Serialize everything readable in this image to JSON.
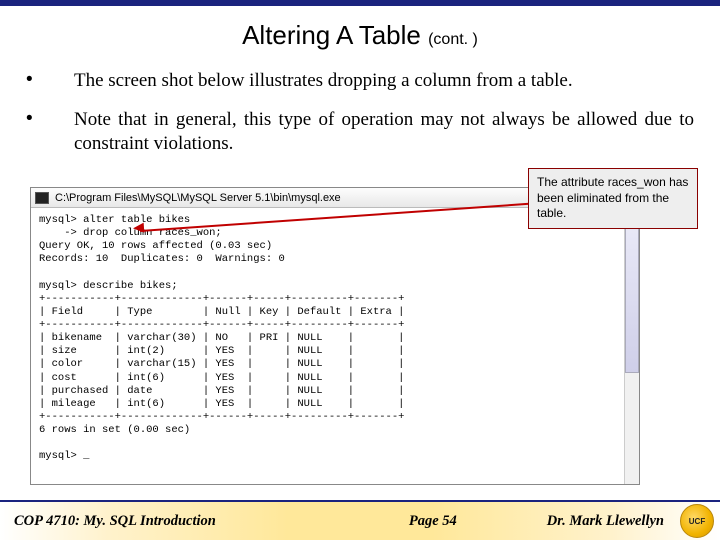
{
  "title": {
    "main": "Altering A Table",
    "cont": "(cont. )"
  },
  "bullets": [
    "The screen shot below illustrates dropping a column from a table.",
    "Note that in general, this type of operation may not always be allowed due to constraint violations."
  ],
  "callout": "The attribute races_won has been eliminated from the table.",
  "screenshot": {
    "path": "C:\\Program Files\\MySQL\\MySQL Server 5.1\\bin\\mysql.exe",
    "lines": [
      "mysql> alter table bikes",
      "    -> drop column races_won;",
      "Query OK, 10 rows affected (0.03 sec)",
      "Records: 10  Duplicates: 0  Warnings: 0",
      "",
      "mysql> describe bikes;",
      "+-----------+-------------+------+-----+---------+-------+",
      "| Field     | Type        | Null | Key | Default | Extra |",
      "+-----------+-------------+------+-----+---------+-------+",
      "| bikename  | varchar(30) | NO   | PRI | NULL    |       |",
      "| size      | int(2)      | YES  |     | NULL    |       |",
      "| color     | varchar(15) | YES  |     | NULL    |       |",
      "| cost      | int(6)      | YES  |     | NULL    |       |",
      "| purchased | date        | YES  |     | NULL    |       |",
      "| mileage   | int(6)      | YES  |     | NULL    |       |",
      "+-----------+-------------+------+-----+---------+-------+",
      "6 rows in set (0.00 sec)",
      "",
      "mysql> _"
    ]
  },
  "footer": {
    "left": "COP 4710: My. SQL Introduction",
    "mid": "Page 54",
    "right": "Dr. Mark Llewellyn"
  },
  "logo_text": "UCF"
}
